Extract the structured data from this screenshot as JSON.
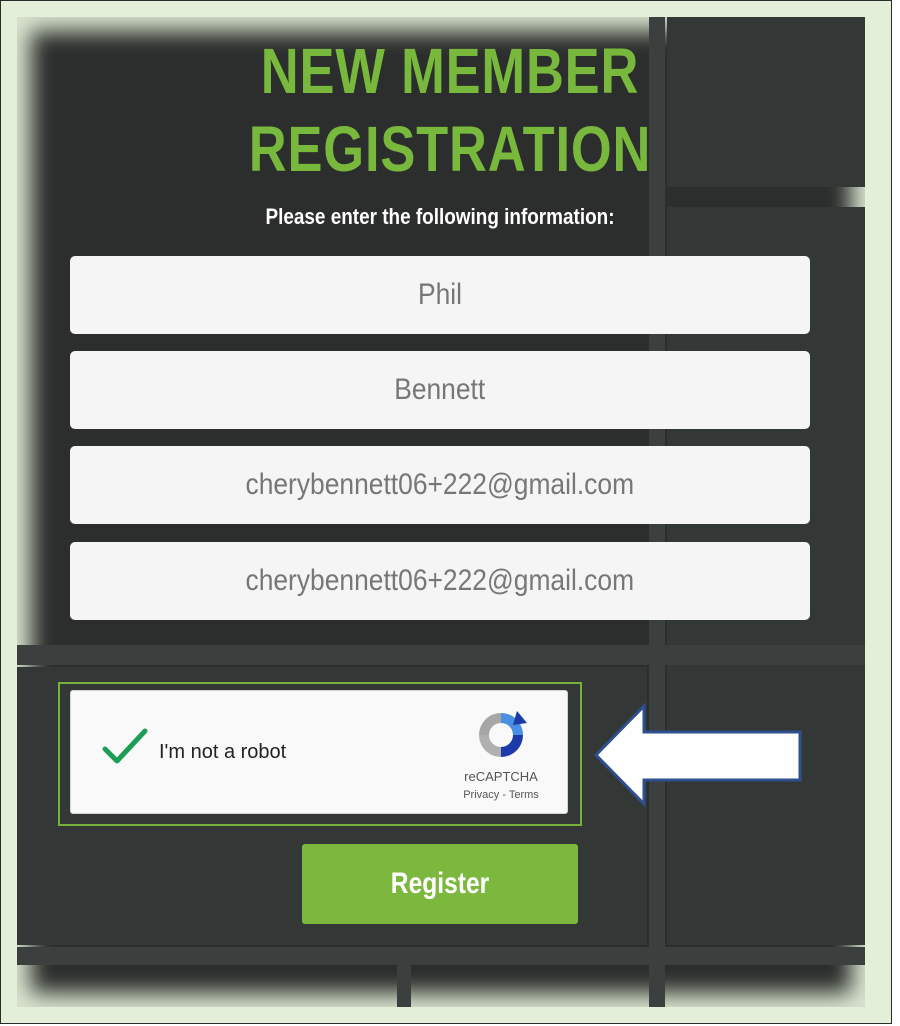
{
  "page": {
    "title_line1": "NEW MEMBER",
    "title_line2": "REGISTRATION",
    "subtitle": "Please enter the following information:"
  },
  "form": {
    "fields": [
      {
        "value": "Phil"
      },
      {
        "value": "Bennett"
      },
      {
        "value": "cherybennett06+222@gmail.com"
      },
      {
        "value": "cherybennett06+222@gmail.com"
      }
    ],
    "register_label": "Register"
  },
  "captcha": {
    "label": "I'm not a robot",
    "checked": true,
    "brand": "reCAPTCHA",
    "links": "Privacy - Terms"
  },
  "colors": {
    "accent_green": "#78b83d",
    "button_green": "#7cb83e",
    "check_green": "#1e9e55",
    "background_dark": "#2b2e2c",
    "frame_bg": "#e4efd9",
    "arrow_fill": "#ffffff",
    "arrow_stroke": "#2f4f8f"
  },
  "icons": {
    "checkmark": "checkmark-icon",
    "recaptcha": "recaptcha-logo-icon",
    "arrow": "left-arrow-icon"
  }
}
